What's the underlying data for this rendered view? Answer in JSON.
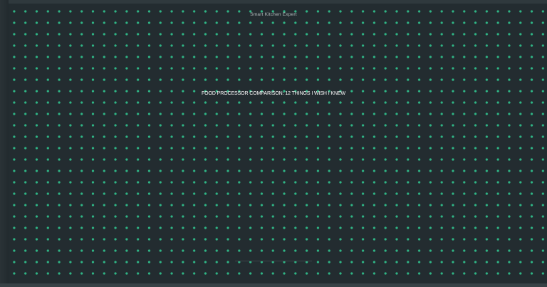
{
  "thumbnail": {
    "channel_name": "Smart Kitchen Expert",
    "title": "FOOD PROCESSOR COMPARISON: 12 THINGS I WISH I KNEW"
  },
  "colors": {
    "background": "#232c30",
    "dot": "#2fb585",
    "title_text": "#ffffff",
    "channel_text": "#b4bcbe"
  }
}
